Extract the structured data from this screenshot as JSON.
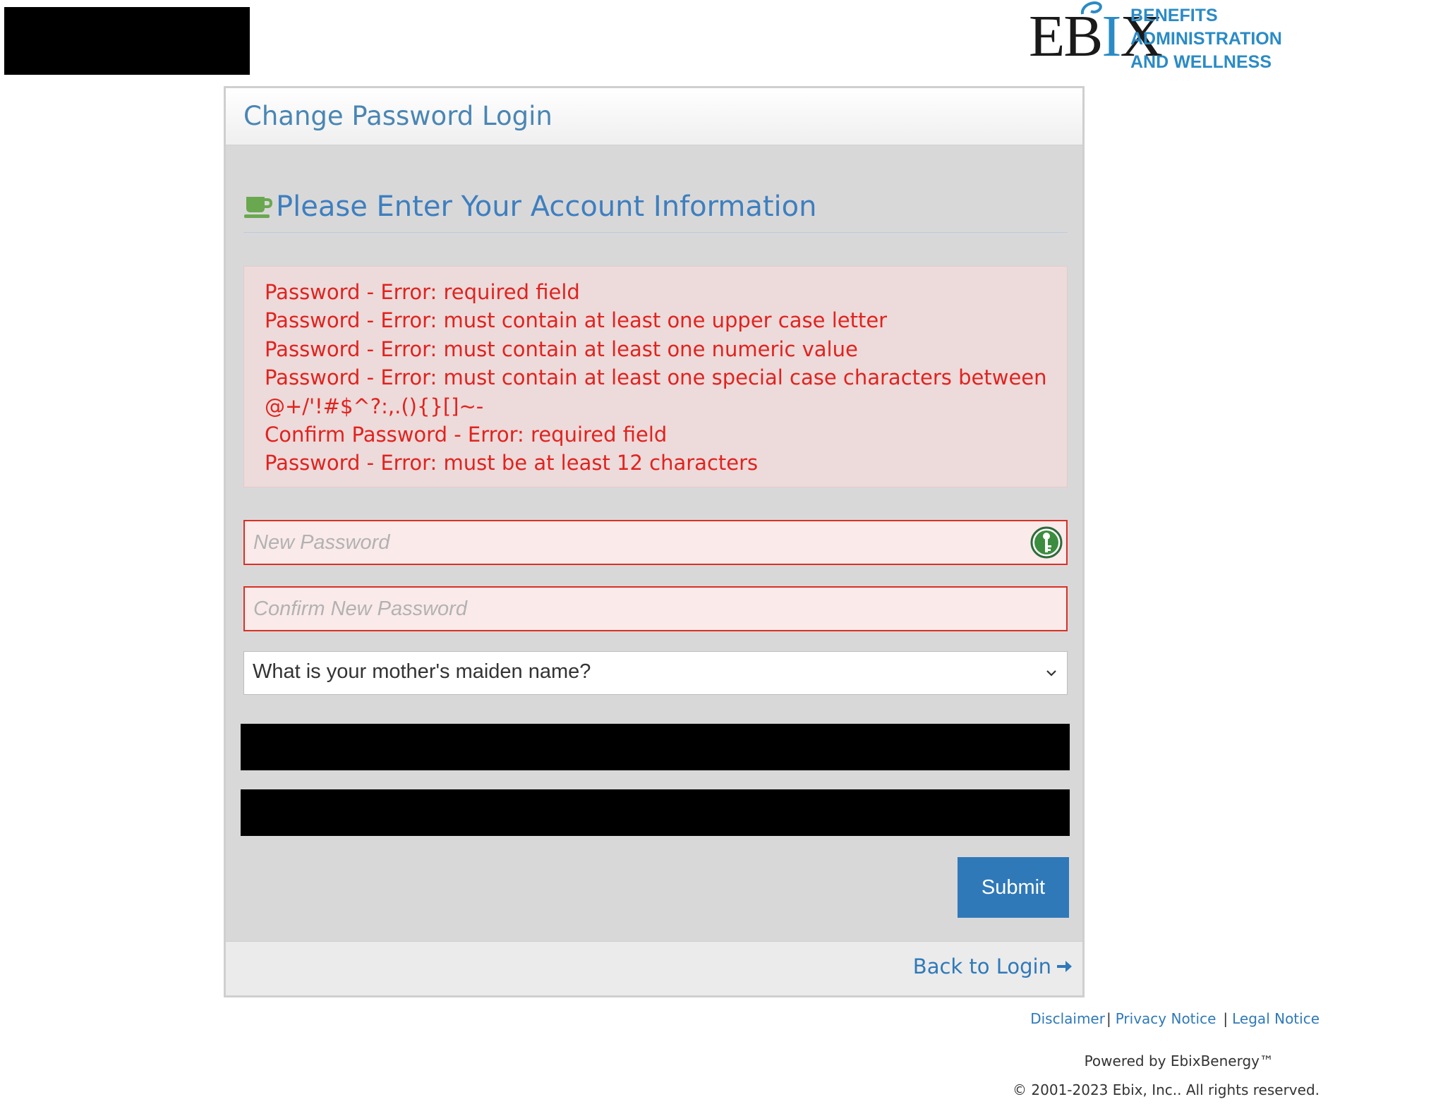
{
  "brand": {
    "word_left": "EB",
    "word_i": "I",
    "word_right": "X",
    "lines": [
      "BENEFITS",
      "ADMINISTRATION",
      "AND WELLNESS"
    ],
    "accent_color": "#2a8bc6"
  },
  "card": {
    "title": "Change Password Login",
    "section_heading": "Please Enter Your Account Information",
    "section_icon": "coffee-cup-icon"
  },
  "errors": [
    "Password - Error: required field",
    "Password - Error: must contain at least one upper case letter",
    "Password - Error: must contain at least one numeric value",
    "Password - Error: must contain at least one special case characters between",
    "@+/'!#$^?:,.(){}[]~-",
    "Confirm Password - Error: required field",
    "Password - Error: must be at least 12 characters"
  ],
  "form": {
    "new_password_placeholder": "New Password",
    "new_password_value": "",
    "confirm_password_placeholder": "Confirm New Password",
    "confirm_password_value": "",
    "security_question_selected": "What is your mother's maiden name?",
    "submit_label": "Submit"
  },
  "nav": {
    "back_label": "Back to Login"
  },
  "footer": {
    "disclaimer": "Disclaimer",
    "privacy": "Privacy Notice",
    "legal": "Legal Notice",
    "separator": "|",
    "powered_by": "Powered by EbixBenergy™",
    "copyright": "© 2001-2023 Ebix, Inc.. All rights reserved."
  },
  "colors": {
    "error_text": "#e0231f",
    "link": "#2f79b9",
    "heading": "#3d7fbf",
    "card_bg": "#d9d8d9",
    "submit_bg": "#2f79b9"
  }
}
